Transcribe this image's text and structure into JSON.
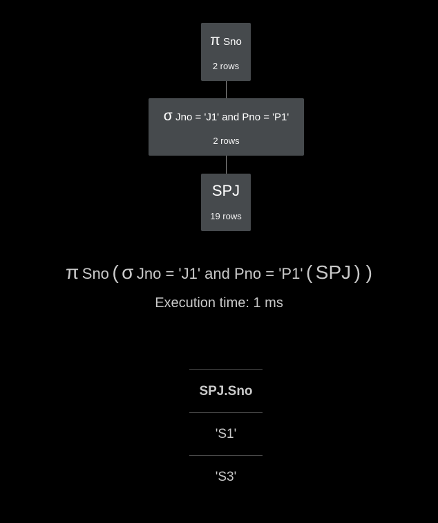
{
  "tree": {
    "project": {
      "symbol": "π",
      "attrs": "Sno",
      "rows": "2 rows"
    },
    "select": {
      "symbol": "σ",
      "condition": "Jno = 'J1' and Pno = 'P1'",
      "rows": "2 rows"
    },
    "table": {
      "name": "SPJ",
      "rows": "19 rows"
    }
  },
  "expression": {
    "proj_symbol": "π",
    "proj_attrs": "Sno",
    "open_paren_1": "(",
    "sel_symbol": "σ",
    "sel_condition": "Jno = 'J1' and Pno = 'P1'",
    "open_paren_2": "(",
    "relation": "SPJ",
    "close_parens": ") )"
  },
  "execution_time": "Execution time: 1 ms",
  "result": {
    "columns": [
      "SPJ.Sno"
    ],
    "rows": [
      [
        "'S1'"
      ],
      [
        "'S3'"
      ]
    ]
  },
  "colors": {
    "background": "#000000",
    "node_fill": "#464a4d",
    "text_primary": "#c9c9c9"
  }
}
